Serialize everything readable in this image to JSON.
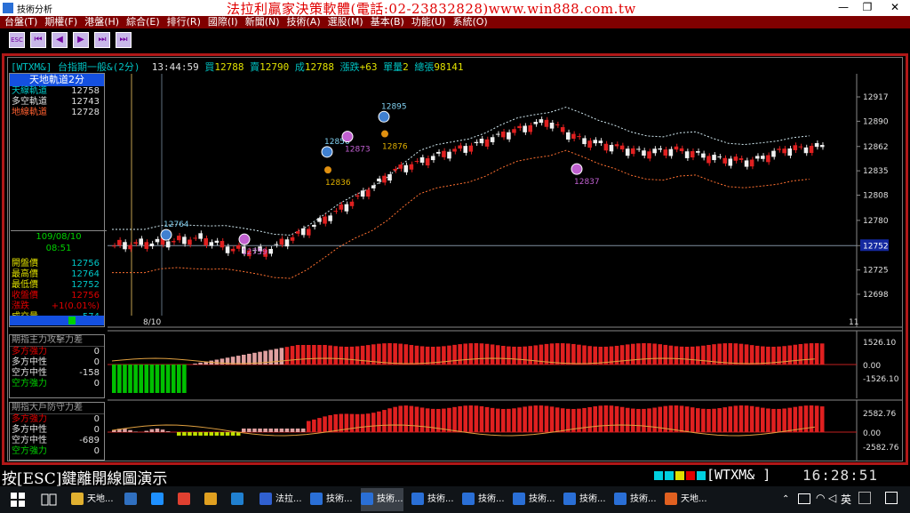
{
  "window": {
    "title": "技術分析",
    "minimize": "—",
    "restore": "❐",
    "close": "✕"
  },
  "banner": "法拉利贏家決策軟體(電話:02-23832828)www.win888.com.tw",
  "menu": [
    "台盤(T)",
    "期權(F)",
    "港盤(H)",
    "綜合(E)",
    "排行(R)",
    "國際(I)",
    "新聞(N)",
    "技術(A)",
    "選股(M)",
    "基本(B)",
    "功能(U)",
    "系統(O)"
  ],
  "toolbar": {
    "esc": "ESC",
    "first": "⏮",
    "prev": "◀",
    "play": "▶",
    "next": "⏭",
    "last": "⏭"
  },
  "infobar": {
    "sym": "[WTXM&]",
    "name": "台指期一般&(2分)",
    "time": "13:44:59",
    "buy_l": "買",
    "buy": "12788",
    "sell_l": "賣",
    "sell": "12790",
    "deal_l": "成",
    "deal": "12788",
    "chg_l": "漲跌",
    "chg": "+63",
    "vol_l": "單量",
    "vol": "2",
    "total_l": "總張",
    "total": "98141"
  },
  "legend": {
    "title": "天地軌道2分",
    "rows": [
      {
        "k": "天線軌道",
        "v": "12758",
        "kc": "#00c8c8"
      },
      {
        "k": "多空軌道",
        "v": "12743",
        "kc": "#e0e0e0"
      },
      {
        "k": "地線軌道",
        "v": "12728",
        "kc": "#ff6030"
      }
    ]
  },
  "quote": {
    "date": "109/08/10",
    "time": "08:51",
    "rows": [
      {
        "k": "開盤價",
        "v": "12756",
        "kc": "#e0e000",
        "vc": "#00c8c8"
      },
      {
        "k": "最高價",
        "v": "12764",
        "kc": "#e0e000",
        "vc": "#00c8c8"
      },
      {
        "k": "最低價",
        "v": "12752",
        "kc": "#e0e000",
        "vc": "#00c8c8"
      },
      {
        "k": "收盤價",
        "v": "12756",
        "kc": "#e00000",
        "vc": "#e00000"
      },
      {
        "k": "漲跌",
        "v": "+1(0.01%)",
        "kc": "#e00000",
        "vc": "#e00000"
      },
      {
        "k": "成交量",
        "v": "574",
        "kc": "#e0e000",
        "vc": "#00c8c8"
      }
    ]
  },
  "price_axis": [
    "12917",
    "12890",
    "12862",
    "12835",
    "12808",
    "12780",
    "12752",
    "12725",
    "12698"
  ],
  "price_current": "12752",
  "time_axis": [
    "8/10",
    "11"
  ],
  "annotations": [
    {
      "label": "12764",
      "kind": "up",
      "price": 12764
    },
    {
      "label": "12759",
      "kind": "buy",
      "price": 12759
    },
    {
      "label": "12856",
      "kind": "up",
      "price": 12856
    },
    {
      "label": "12836",
      "kind": "dot",
      "price": 12836
    },
    {
      "label": "12873",
      "kind": "buy",
      "price": 12873
    },
    {
      "label": "12895",
      "kind": "up",
      "price": 12895
    },
    {
      "label": "12876",
      "kind": "dot",
      "price": 12876
    },
    {
      "label": "12837",
      "kind": "buy",
      "price": 12837
    }
  ],
  "panel1": {
    "title": "期指主力攻擊力差",
    "rows": [
      {
        "k": "多方強力",
        "v": "0",
        "kc": "#e00000"
      },
      {
        "k": "多方中性",
        "v": "0",
        "kc": "#e0e0e0"
      },
      {
        "k": "空方中性",
        "v": "-158",
        "kc": "#e0e0e0"
      },
      {
        "k": "空方強力",
        "v": "0",
        "kc": "#00d000"
      }
    ],
    "axis": [
      "1526.10",
      "0.00",
      "-1526.10"
    ]
  },
  "panel2": {
    "title": "期指大戶防守力差",
    "rows": [
      {
        "k": "多方強力",
        "v": "0",
        "kc": "#e00000"
      },
      {
        "k": "多方中性",
        "v": "0",
        "kc": "#e0e0e0"
      },
      {
        "k": "空方中性",
        "v": "-689",
        "kc": "#e0e0e0"
      },
      {
        "k": "空方強力",
        "v": "0",
        "kc": "#00d000"
      }
    ],
    "axis": [
      "2582.76",
      "0.00",
      "-2582.76"
    ]
  },
  "status": {
    "msg": "按[ESC]鍵離開線圖演示",
    "symbol": "[WTXM&  ]",
    "clock": "16:28:51"
  },
  "taskbar": {
    "items": [
      {
        "label": "天地...",
        "color": "#e0b030"
      },
      {
        "label": "",
        "color": "#3070c0"
      },
      {
        "label": "",
        "color": "#1e90ff"
      },
      {
        "label": "",
        "color": "#e04030"
      },
      {
        "label": "",
        "color": "#e0a020"
      },
      {
        "label": "",
        "color": "#2080d0"
      },
      {
        "label": "法拉...",
        "color": "#3060d0"
      },
      {
        "label": "技術...",
        "color": "#2a6fd6"
      },
      {
        "label": "技術...",
        "color": "#2a6fd6"
      },
      {
        "label": "技術...",
        "color": "#2a6fd6"
      },
      {
        "label": "技術...",
        "color": "#2a6fd6"
      },
      {
        "label": "技術...",
        "color": "#2a6fd6"
      },
      {
        "label": "技術...",
        "color": "#2a6fd6"
      },
      {
        "label": "技術...",
        "color": "#2a6fd6"
      },
      {
        "label": "天地...",
        "color": "#e06020"
      }
    ],
    "tray": {
      "ime": "英",
      "chevron": "⌃"
    }
  }
}
